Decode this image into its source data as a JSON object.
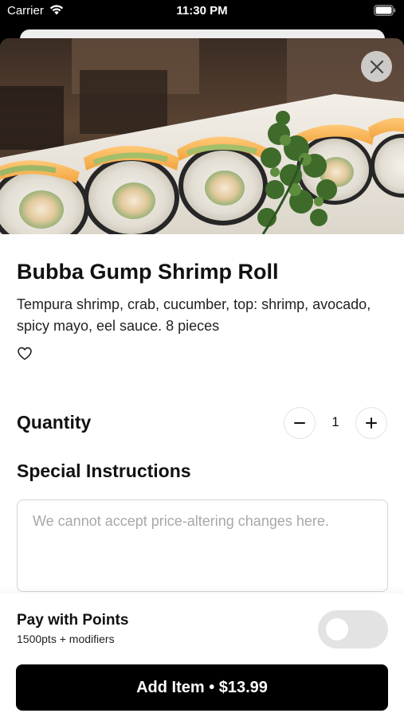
{
  "status_bar": {
    "carrier": "Carrier",
    "time": "11:30 PM",
    "wifi_icon": "wifi-icon",
    "battery_icon": "battery-icon"
  },
  "hero": {
    "close_icon": "close-icon"
  },
  "item": {
    "title": "Bubba Gump Shrimp Roll",
    "description": "Tempura shrimp, crab, cucumber, top: shrimp, avocado, spicy mayo, eel sauce. 8 pieces",
    "favorite_icon": "heart-outline-icon"
  },
  "quantity": {
    "label": "Quantity",
    "value": "1",
    "minus_icon": "minus-icon",
    "plus_icon": "plus-icon"
  },
  "special_instructions": {
    "label": "Special Instructions",
    "value": "",
    "placeholder": "We cannot accept price-altering changes here."
  },
  "pay_with_points": {
    "title": "Pay with Points",
    "subtitle": "1500pts + modifiers",
    "enabled": false
  },
  "add_button": {
    "label": "Add Item • $13.99"
  },
  "colors": {
    "primary_button": "#000000",
    "toggle_off": "#e3e3e3"
  }
}
